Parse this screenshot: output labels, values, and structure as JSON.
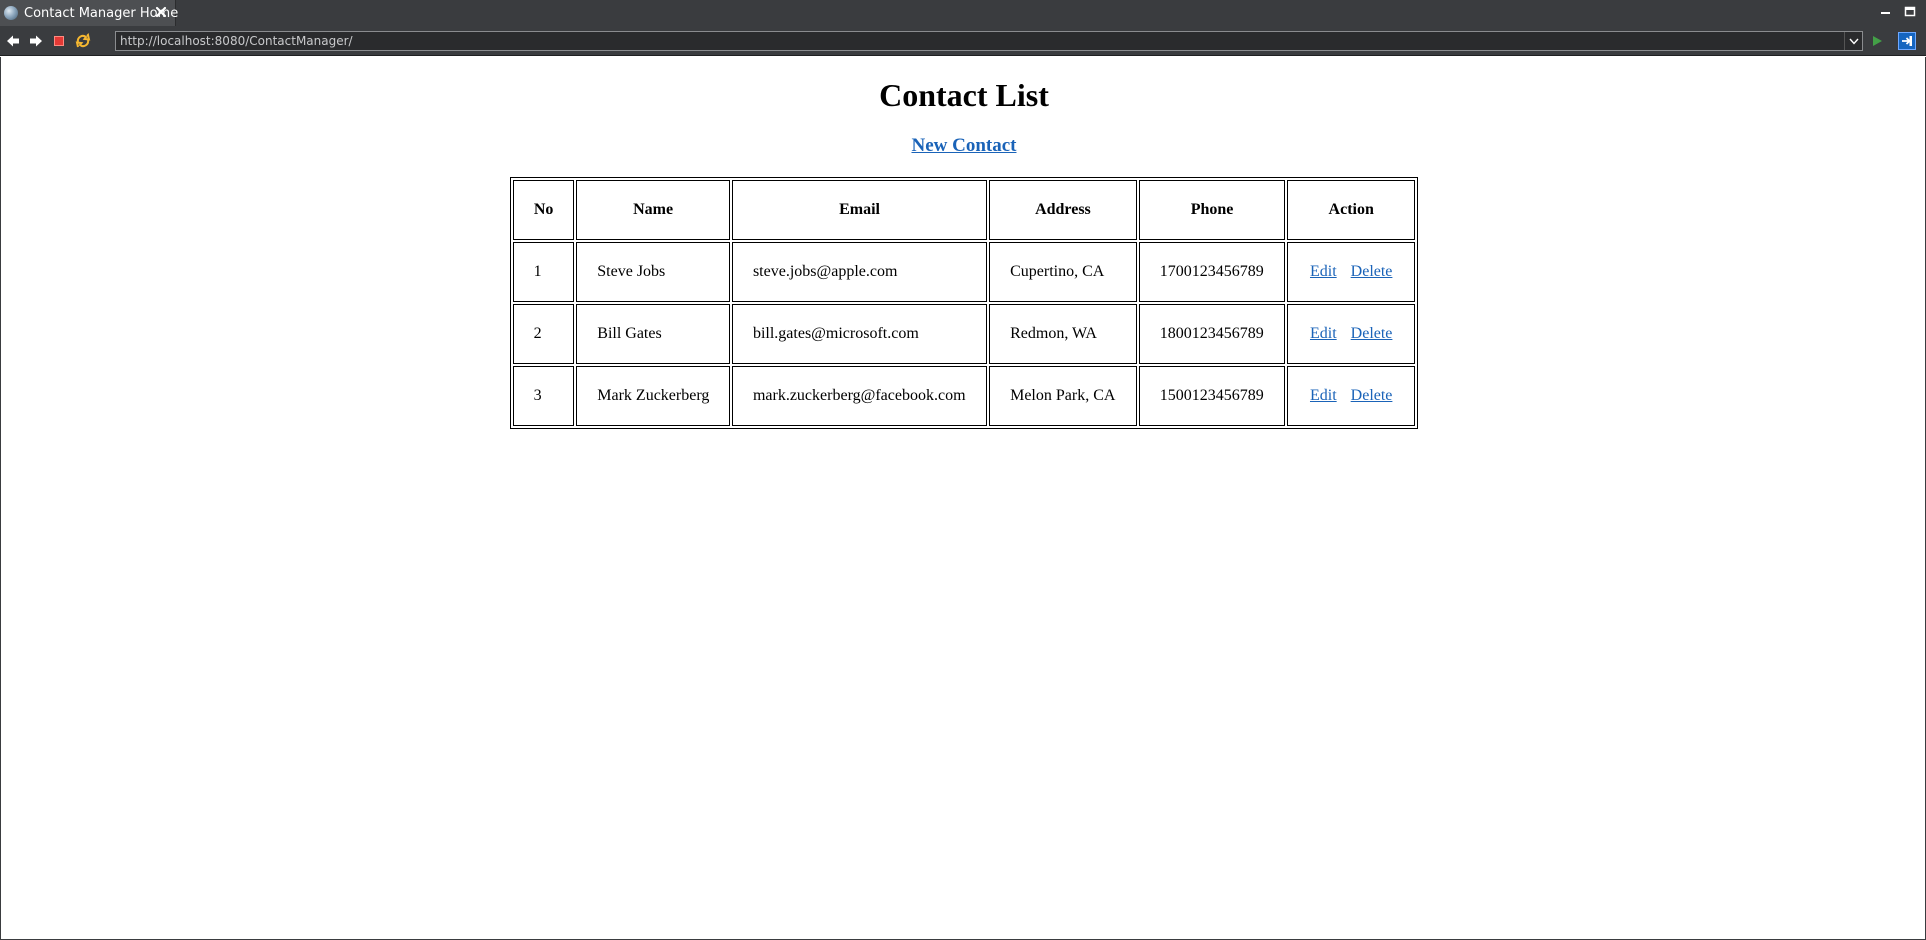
{
  "browser": {
    "tab_title": "Contact Manager Home",
    "url": "http://localhost:8080/ContactManager/"
  },
  "page": {
    "title": "Contact List",
    "new_contact_link": "New Contact"
  },
  "table": {
    "headers": [
      "No",
      "Name",
      "Email",
      "Address",
      "Phone",
      "Action"
    ],
    "rows": [
      {
        "no": "1",
        "name": "Steve Jobs",
        "email": "steve.jobs@apple.com",
        "address": "Cupertino, CA",
        "phone": "1700123456789",
        "edit": "Edit",
        "delete": "Delete"
      },
      {
        "no": "2",
        "name": "Bill Gates",
        "email": "bill.gates@microsoft.com",
        "address": "Redmon, WA",
        "phone": "1800123456789",
        "edit": "Edit",
        "delete": "Delete"
      },
      {
        "no": "3",
        "name": "Mark Zuckerberg",
        "email": "mark.zuckerberg@facebook.com",
        "address": "Melon Park, CA",
        "phone": "1500123456789",
        "edit": "Edit",
        "delete": "Delete"
      }
    ]
  },
  "colors": {
    "chrome_bg": "#3a3c3f",
    "link": "#1a63b8",
    "accent": "#1565c0"
  },
  "icons": [
    "globe-icon",
    "close-icon",
    "minimize-icon",
    "maximize-icon",
    "back-icon",
    "forward-icon",
    "stop-icon",
    "refresh-icon",
    "dropdown-icon",
    "go-icon",
    "external-browser-icon"
  ]
}
